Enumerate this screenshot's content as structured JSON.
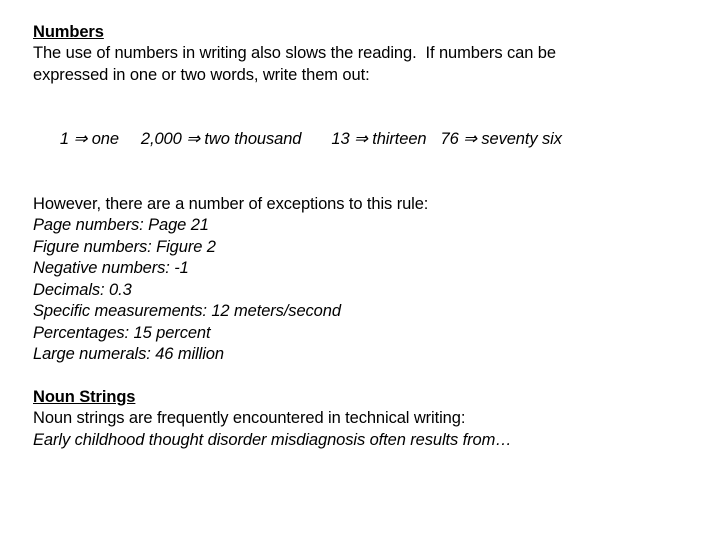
{
  "slide": {
    "background_color": "#ffffff",
    "text_color": "#000000",
    "sections": {
      "numbers": {
        "heading": "Numbers",
        "intro_line_1": "The use of numbers in writing also slows the reading.  If numbers can be",
        "intro_line_2": "expressed in one or two words, write them out:",
        "examples": [
          {
            "numeral": "1",
            "arrow": "⇒",
            "words": "one"
          },
          {
            "numeral": "2,000",
            "arrow": "⇒",
            "words": "two thousand"
          },
          {
            "numeral": "13",
            "arrow": "⇒",
            "words": "thirteen"
          },
          {
            "numeral": "76",
            "arrow": "⇒",
            "words": "seventy six"
          }
        ],
        "exceptions_intro": "However, there are a number of exceptions to this rule:",
        "exceptions": [
          "Page numbers: Page 21",
          "Figure numbers: Figure 2",
          "Negative numbers: -1",
          "Decimals: 0.3",
          "Specific measurements: 12 meters/second",
          "Percentages: 15 percent",
          "Large numerals: 46 million"
        ]
      },
      "noun_strings": {
        "heading": "Noun Strings",
        "intro_line": "Noun strings are frequently encountered in technical writing:",
        "example_line": "Early childhood thought disorder misdiagnosis often results from…"
      }
    }
  }
}
